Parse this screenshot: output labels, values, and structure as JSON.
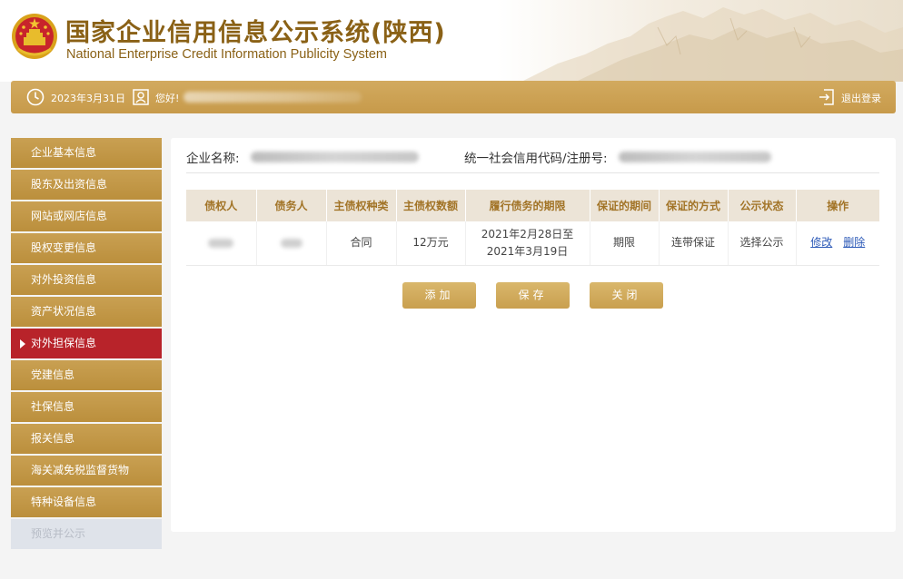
{
  "header": {
    "title": "国家企业信用信息公示系统(陕西)",
    "subtitle": "National Enterprise Credit Information Publicity System",
    "emblem_icon": "national-emblem-icon",
    "brand_color": "#8a6116"
  },
  "topbar": {
    "date": "2023年3月31日",
    "greeting": "您好!",
    "logout_label": "退出登录",
    "bar_color": "#c99f4f"
  },
  "sidebar": {
    "items": [
      {
        "label": "企业基本信息",
        "state": "normal"
      },
      {
        "label": "股东及出资信息",
        "state": "normal"
      },
      {
        "label": "网站或网店信息",
        "state": "normal"
      },
      {
        "label": "股权变更信息",
        "state": "normal"
      },
      {
        "label": "对外投资信息",
        "state": "normal"
      },
      {
        "label": "资产状况信息",
        "state": "normal"
      },
      {
        "label": "对外担保信息",
        "state": "active"
      },
      {
        "label": "党建信息",
        "state": "normal"
      },
      {
        "label": "社保信息",
        "state": "normal"
      },
      {
        "label": "报关信息",
        "state": "normal"
      },
      {
        "label": "海关减免税监督货物",
        "state": "normal"
      },
      {
        "label": "特种设备信息",
        "state": "normal"
      },
      {
        "label": "预览并公示",
        "state": "disabled"
      }
    ],
    "active_color": "#b8232a"
  },
  "company": {
    "name_label": "企业名称:",
    "code_label": "统一社会信用代码/注册号:"
  },
  "table": {
    "headers": [
      "债权人",
      "债务人",
      "主债权种类",
      "主债权数额",
      "履行债务的期限",
      "保证的期间",
      "保证的方式",
      "公示状态",
      "操作"
    ],
    "rows": [
      {
        "type": "合同",
        "amount": "12万元",
        "term_line1": "2021年2月28日至",
        "term_line2": "2021年3月19日",
        "period": "期限",
        "method": "连带保证",
        "status": "选择公示",
        "edit_label": "修改",
        "delete_label": "删除"
      }
    ]
  },
  "actions": {
    "add_label": "添加",
    "save_label": "保存",
    "close_label": "关闭"
  }
}
